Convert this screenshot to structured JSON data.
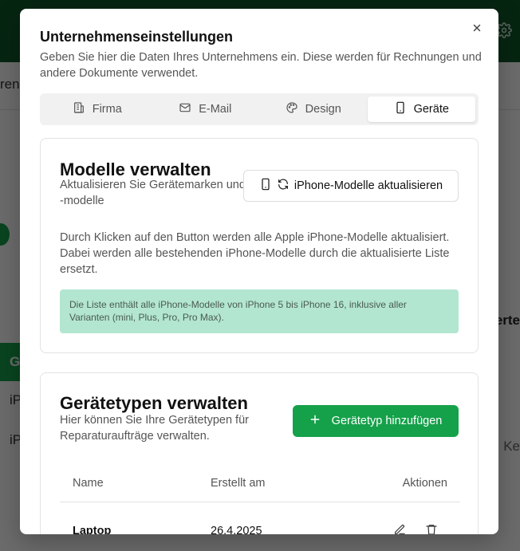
{
  "background": {
    "subbar_fragment": "ren",
    "green_row_fragment": "Ge",
    "row_fragments": [
      "iP",
      "iP"
    ],
    "right_bold_fragment": "erte",
    "right_text_fragment": "Ke"
  },
  "modal": {
    "title": "Unternehmenseinstellungen",
    "description": "Geben Sie hier die Daten Ihres Unternehmens ein. Diese werden für Rechnungen und andere Dokumente verwendet.",
    "close_icon": "close-icon"
  },
  "tabs": [
    {
      "label": "Firma",
      "icon": "building-icon",
      "active": false
    },
    {
      "label": "E-Mail",
      "icon": "mail-icon",
      "active": false
    },
    {
      "label": "Design",
      "icon": "palette-icon",
      "active": false
    },
    {
      "label": "Geräte",
      "icon": "smartphone-icon",
      "active": true
    }
  ],
  "models_card": {
    "title": "Modelle verwalten",
    "subtitle": "Aktualisieren Sie Gerätemarken und -modelle",
    "update_button": "iPhone-Modelle aktualisieren",
    "text": "Durch Klicken auf den Button werden alle Apple iPhone-Modelle aktualisiert. Dabei werden alle bestehenden iPhone-Modelle durch die aktualisierte Liste ersetzt.",
    "info": "Die Liste enthält alle iPhone-Modelle von iPhone 5 bis iPhone 16, inklusive aller Varianten (mini, Plus, Pro, Pro Max)."
  },
  "types_card": {
    "title": "Gerätetypen verwalten",
    "subtitle": "Hier können Sie Ihre Gerätetypen für Reparaturaufträge verwalten.",
    "add_button": "Gerätetyp hinzufügen",
    "columns": {
      "name": "Name",
      "created": "Erstellt am",
      "actions": "Aktionen"
    },
    "rows": [
      {
        "name": "Laptop",
        "created": "26.4.2025"
      }
    ]
  },
  "colors": {
    "primary": "#15a14a",
    "info_bg": "#b3e6d1",
    "header_bg": "#0f5a2a"
  }
}
